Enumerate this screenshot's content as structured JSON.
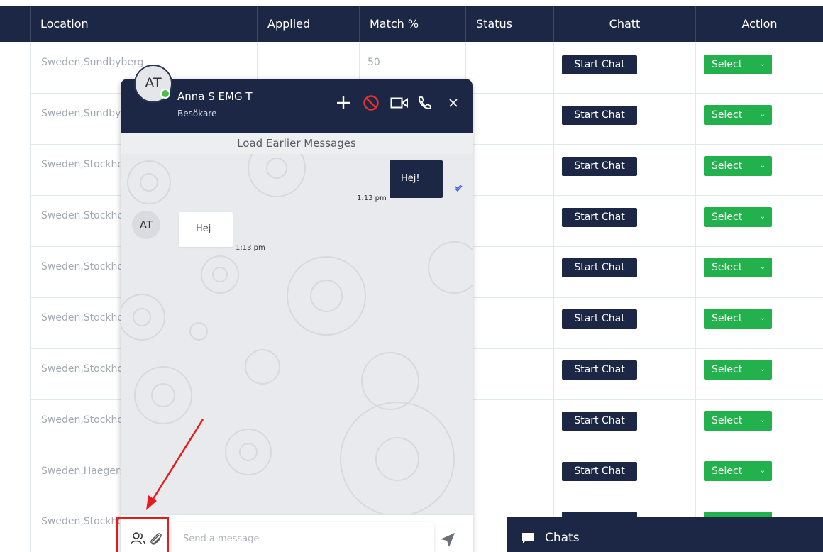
{
  "table": {
    "columns": [
      "Location",
      "Applied",
      "Match %",
      "Status",
      "Chatt",
      "Action"
    ],
    "rows": [
      {
        "location": "Sweden,Sundbyberg",
        "match": "50",
        "chat_label": "Start Chat",
        "action_label": "Select"
      },
      {
        "location": "Sweden,Sundbyberg",
        "match": "",
        "chat_label": "Start Chat",
        "action_label": "Select"
      },
      {
        "location": "Sweden,Stockholm",
        "match": "",
        "chat_label": "Start Chat",
        "action_label": "Select"
      },
      {
        "location": "Sweden,Stockholm",
        "match": "",
        "chat_label": "Start Chat",
        "action_label": "Select"
      },
      {
        "location": "Sweden,Stockholm",
        "match": "",
        "chat_label": "Start Chat",
        "action_label": "Select"
      },
      {
        "location": "Sweden,Stockholm",
        "match": "",
        "chat_label": "Start Chat",
        "action_label": "Select"
      },
      {
        "location": "Sweden,Stockholm",
        "match": "",
        "chat_label": "Start Chat",
        "action_label": "Select"
      },
      {
        "location": "Sweden,Stockholm",
        "match": "",
        "chat_label": "Start Chat",
        "action_label": "Select"
      },
      {
        "location": "Sweden,Haegersten",
        "match": "",
        "chat_label": "Start Chat",
        "action_label": "Select"
      },
      {
        "location": "Sweden,Stockholm",
        "match": "",
        "chat_label": "",
        "action_label": ""
      }
    ]
  },
  "chat": {
    "avatar_initials": "AT",
    "contact_name": "Anna S EMG T",
    "contact_role": "Besökare",
    "load_earlier": "Load Earlier Messages",
    "messages": [
      {
        "direction": "outgoing",
        "text": "Hej!",
        "time": "1:13 pm"
      },
      {
        "direction": "incoming",
        "sender_initials": "AT",
        "text": "Hej",
        "time": "1:13 pm"
      }
    ],
    "composer_placeholder": "Send a message",
    "icons": {
      "add": "plus-icon",
      "block": "block-icon",
      "video": "video-camera-icon",
      "call": "phone-icon",
      "close": "close-icon",
      "participants": "users-icon",
      "attach": "paperclip-icon",
      "send": "send-icon",
      "seen": "double-check-icon"
    },
    "status_color": "#4cbb47"
  },
  "chats_bar": {
    "label": "Chats",
    "icon": "chat-bubble-icon"
  },
  "colors": {
    "navy": "#1b2744",
    "green": "#22b14c",
    "annotation_red": "#e81b1b"
  }
}
